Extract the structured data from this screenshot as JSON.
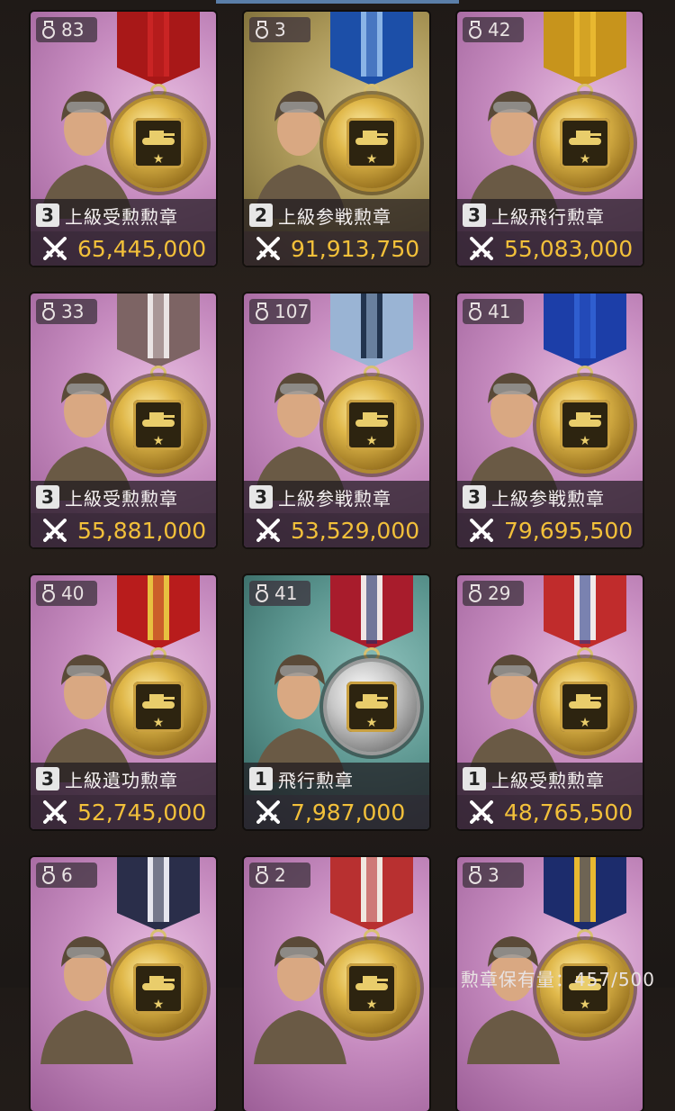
{
  "cards": [
    {
      "count": "83",
      "level": "3",
      "name": "上級受勲勲章",
      "value": "65,445,000",
      "theme": "pink",
      "ribbon": [
        "#a81818",
        "#c92424",
        "#a81818"
      ]
    },
    {
      "count": "3",
      "level": "2",
      "name": "上級参戦勲章",
      "value": "91,913,750",
      "theme": "gold",
      "ribbon": [
        "#1c4fa8",
        "#8ab4e6",
        "#1c4fa8"
      ]
    },
    {
      "count": "42",
      "level": "3",
      "name": "上級飛行勲章",
      "value": "55,083,000",
      "theme": "pink",
      "ribbon": [
        "#c7941c",
        "#e8b830",
        "#c7941c"
      ]
    },
    {
      "count": "33",
      "level": "3",
      "name": "上級受勲勲章",
      "value": "55,881,000",
      "theme": "pink",
      "ribbon": [
        "#7d6464",
        "#eae4e4",
        "#7d6464"
      ]
    },
    {
      "count": "107",
      "level": "3",
      "name": "上級参戦勲章",
      "value": "53,529,000",
      "theme": "pink",
      "ribbon": [
        "#9ab4d4",
        "#22344e",
        "#9ab4d4"
      ]
    },
    {
      "count": "41",
      "level": "3",
      "name": "上級参戦勲章",
      "value": "79,695,500",
      "theme": "pink",
      "ribbon": [
        "#1c3ea8",
        "#2f5ed0",
        "#1c3ea8"
      ]
    },
    {
      "count": "40",
      "level": "3",
      "name": "上級遺功勲章",
      "value": "52,745,000",
      "theme": "pink",
      "ribbon": [
        "#b81c1c",
        "#e8c040",
        "#b81c1c"
      ]
    },
    {
      "count": "41",
      "level": "1",
      "name": "飛行勲章",
      "value": "7,987,000",
      "theme": "teal",
      "ribbon": [
        "#a81c2c",
        "#f0e6e6",
        "#1c2c68"
      ]
    },
    {
      "count": "29",
      "level": "1",
      "name": "上級受勲勲章",
      "value": "48,765,500",
      "theme": "pink",
      "ribbon": [
        "#c02c2c",
        "#f0eaea",
        "#2c3c88"
      ]
    },
    {
      "count": "6",
      "level": "",
      "name": "",
      "value": "",
      "theme": "pink",
      "ribbon": [
        "#2a2e4a",
        "#e6e6ee",
        "#2a2e4a"
      ]
    },
    {
      "count": "2",
      "level": "",
      "name": "",
      "value": "",
      "theme": "pink",
      "ribbon": [
        "#b83030",
        "#f0e8e0",
        "#b83030"
      ]
    },
    {
      "count": "3",
      "level": "",
      "name": "",
      "value": "",
      "theme": "pink",
      "ribbon": [
        "#1c2c6c",
        "#e8b830",
        "#1c2c6c"
      ]
    }
  ],
  "footer": {
    "text": "勲章保有量：457/500"
  }
}
